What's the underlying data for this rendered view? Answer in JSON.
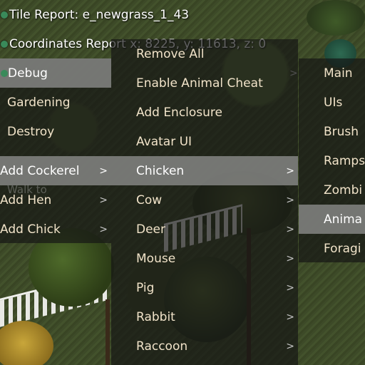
{
  "report": {
    "tile": "Tile Report: e_newgrass_1_43",
    "coordinates": "Coordinates Report x: 8225, y: 11613, z: 0"
  },
  "main_menu": {
    "items": [
      {
        "label": "Debug",
        "arrow": ">"
      },
      {
        "label": "Gardening"
      },
      {
        "label": "Destroy"
      },
      {
        "label": "Add Cockerel",
        "arrow": ">"
      },
      {
        "label": "Add Hen",
        "arrow": ">"
      },
      {
        "label": "Add Chick",
        "arrow": ">"
      }
    ],
    "faded_labels": [
      "Walk to"
    ]
  },
  "debug_menu": {
    "items": [
      {
        "label": "Remove All"
      },
      {
        "label": "Enable Animal Cheat"
      },
      {
        "label": "Add Enclosure"
      },
      {
        "label": "Avatar UI"
      },
      {
        "label": "Chicken",
        "arrow": ">"
      },
      {
        "label": "Cow",
        "arrow": ">"
      },
      {
        "label": "Deer",
        "arrow": ">"
      },
      {
        "label": "Mouse",
        "arrow": ">"
      },
      {
        "label": "Pig",
        "arrow": ">"
      },
      {
        "label": "Rabbit",
        "arrow": ">"
      },
      {
        "label": "Raccoon",
        "arrow": ">"
      }
    ]
  },
  "cheats_menu": {
    "items": [
      {
        "label": "Main"
      },
      {
        "label": "UIs"
      },
      {
        "label": "Brush"
      },
      {
        "label": "Ramps"
      },
      {
        "label": "Zombi"
      },
      {
        "label": "Anima"
      },
      {
        "label": "Foragi"
      }
    ]
  },
  "colors": {
    "menu_bg": "#141414",
    "highlight_bg": "#969696",
    "menu_text": "#f1e3c9"
  }
}
